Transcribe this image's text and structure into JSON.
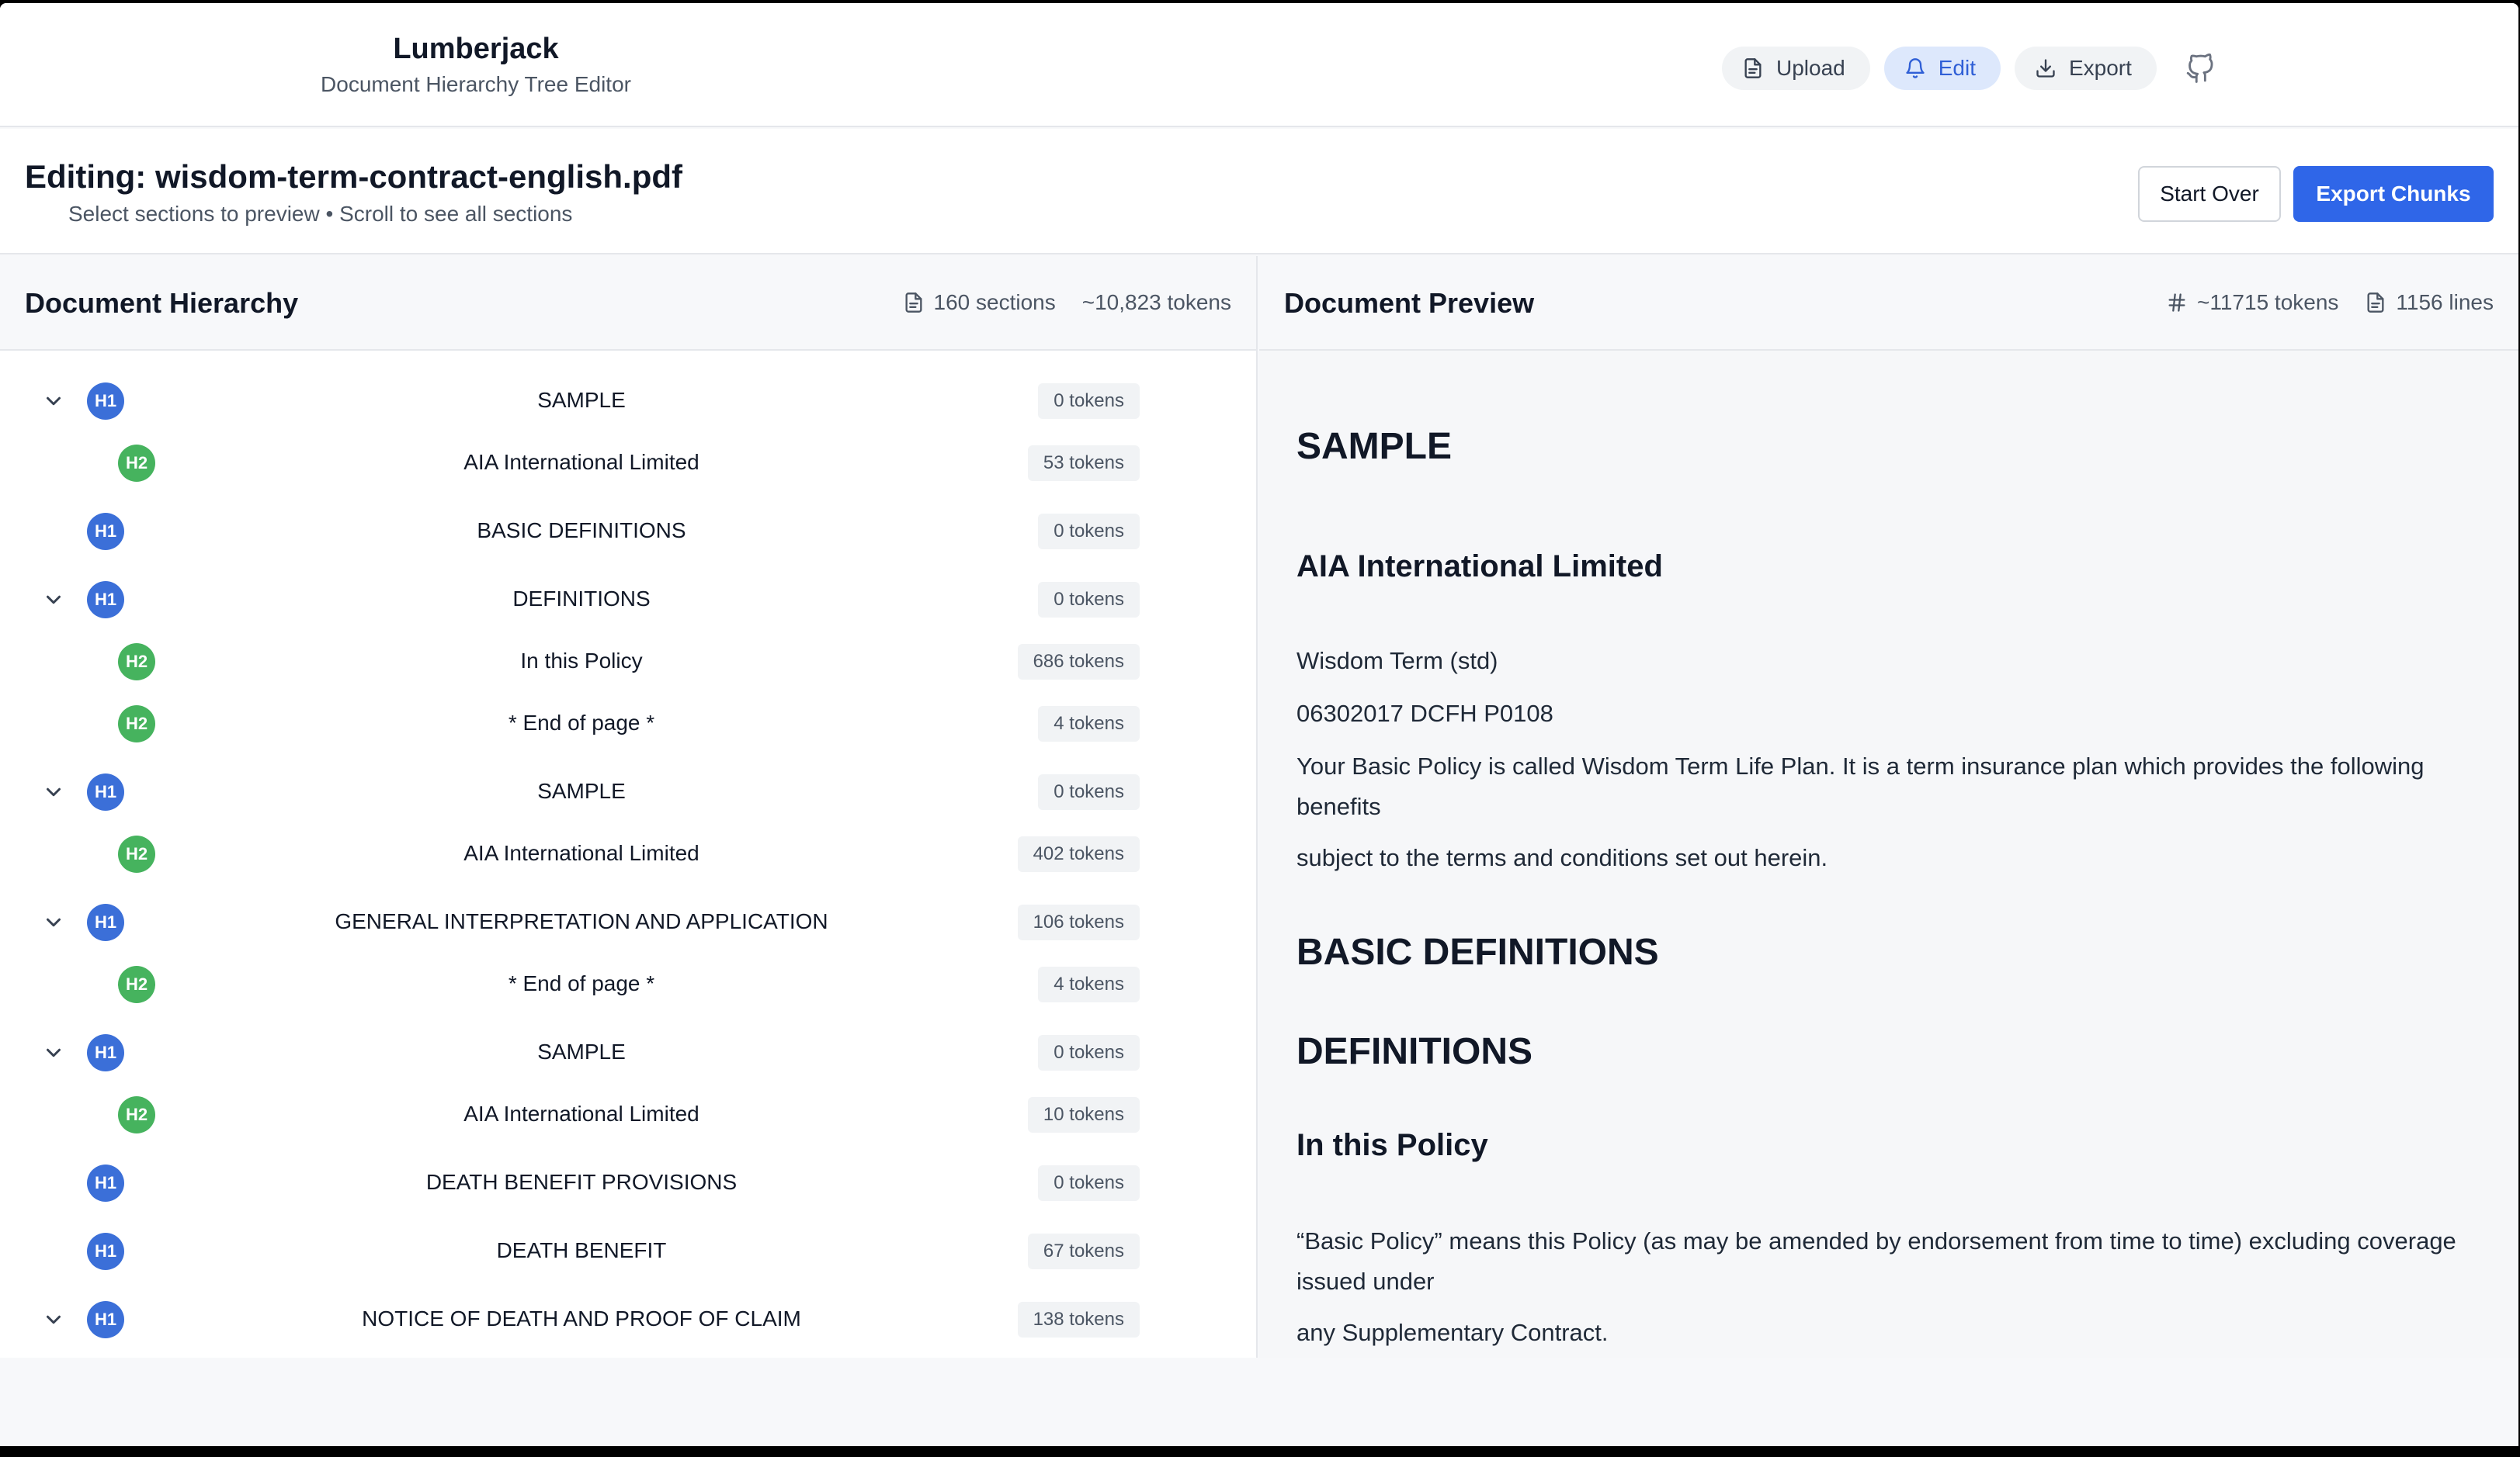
{
  "app": {
    "title": "Lumberjack",
    "subtitle": "Document Hierarchy Tree Editor"
  },
  "nav": {
    "upload": "Upload",
    "edit": "Edit",
    "export": "Export"
  },
  "editing": {
    "title": "Editing: wisdom-term-contract-english.pdf",
    "subtitle": "Select sections to preview • Scroll to see all sections",
    "start_over": "Start Over",
    "export_chunks": "Export Chunks"
  },
  "hierarchy": {
    "title": "Document Hierarchy",
    "sections": "160 sections",
    "tokens": "~10,823 tokens",
    "rows": [
      {
        "level": "H1",
        "label": "SAMPLE",
        "tokens": "0 tokens",
        "expandable": true
      },
      {
        "level": "H2",
        "label": "AIA International Limited",
        "tokens": "53 tokens",
        "expandable": false
      },
      {
        "level": "H1",
        "label": "BASIC DEFINITIONS",
        "tokens": "0 tokens",
        "expandable": false
      },
      {
        "level": "H1",
        "label": "DEFINITIONS",
        "tokens": "0 tokens",
        "expandable": true
      },
      {
        "level": "H2",
        "label": "In this Policy",
        "tokens": "686 tokens",
        "expandable": false
      },
      {
        "level": "H2",
        "label": "* End of page *",
        "tokens": "4 tokens",
        "expandable": false
      },
      {
        "level": "H1",
        "label": "SAMPLE",
        "tokens": "0 tokens",
        "expandable": true
      },
      {
        "level": "H2",
        "label": "AIA International Limited",
        "tokens": "402 tokens",
        "expandable": false
      },
      {
        "level": "H1",
        "label": "GENERAL INTERPRETATION AND APPLICATION",
        "tokens": "106 tokens",
        "expandable": true
      },
      {
        "level": "H2",
        "label": "* End of page *",
        "tokens": "4 tokens",
        "expandable": false
      },
      {
        "level": "H1",
        "label": "SAMPLE",
        "tokens": "0 tokens",
        "expandable": true
      },
      {
        "level": "H2",
        "label": "AIA International Limited",
        "tokens": "10 tokens",
        "expandable": false
      },
      {
        "level": "H1",
        "label": "DEATH BENEFIT PROVISIONS",
        "tokens": "0 tokens",
        "expandable": false
      },
      {
        "level": "H1",
        "label": "DEATH BENEFIT",
        "tokens": "67 tokens",
        "expandable": false
      },
      {
        "level": "H1",
        "label": "NOTICE OF DEATH AND PROOF OF CLAIM",
        "tokens": "138 tokens",
        "expandable": true
      }
    ]
  },
  "preview": {
    "title": "Document Preview",
    "tokens": "~11715 tokens",
    "lines": "1156 lines",
    "h_sample": "SAMPLE",
    "h_aia": "AIA International Limited",
    "p1": "Wisdom Term (std)",
    "p2": "06302017 DCFH P0108",
    "p3": "Your Basic Policy is called Wisdom Term Life Plan. It is a term insurance plan which provides the following benefits",
    "p4": "subject to the terms and conditions set out herein.",
    "h_basic": "BASIC DEFINITIONS",
    "h_definitions": "DEFINITIONS",
    "h_in_policy": "In this Policy",
    "p5": "“Basic Policy” means this Policy (as may be amended by endorsement from time to time) excluding coverage issued under",
    "p6": "any Supplementary Contract."
  },
  "colors": {
    "accent": "#2f66e8",
    "h1_badge": "#3b6fd8",
    "h2_badge": "#46b35e"
  }
}
